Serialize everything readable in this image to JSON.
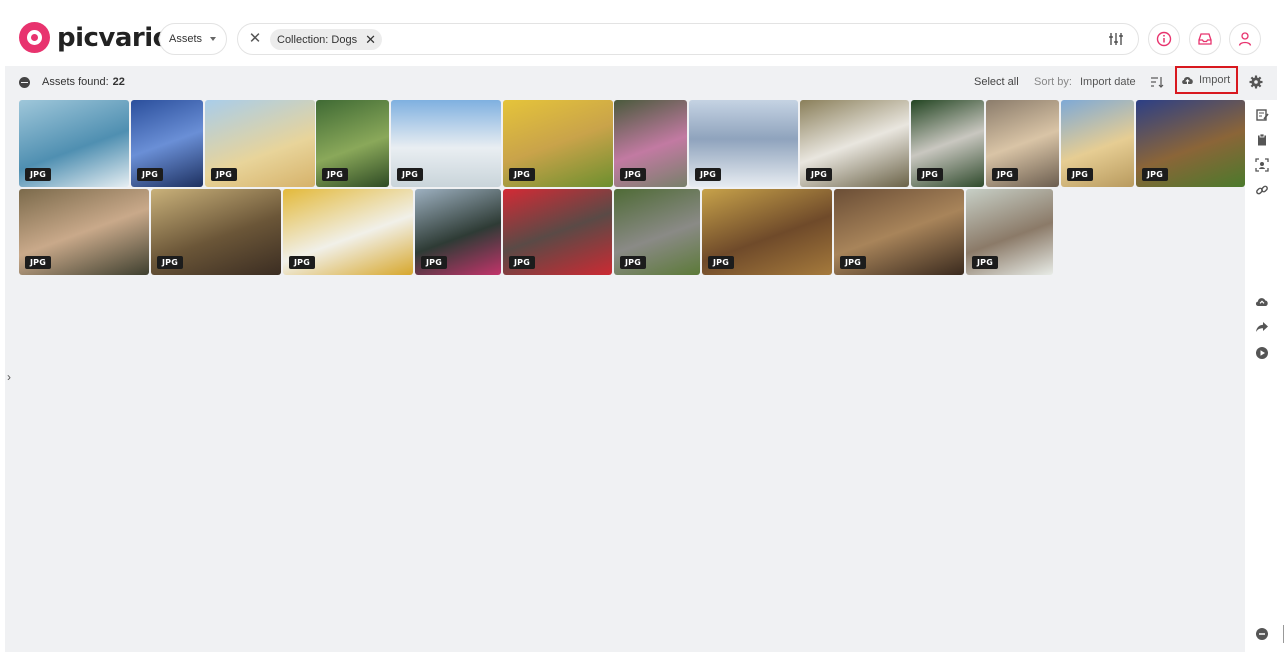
{
  "app": {
    "name": "picvario"
  },
  "header": {
    "scope_select": "Assets",
    "search_chip": "Collection: Dogs",
    "icons": [
      "filter-sliders-icon",
      "info-icon",
      "inbox-icon",
      "user-icon"
    ]
  },
  "toolbar": {
    "assets_found_label": "Assets found:",
    "assets_found_count": "22",
    "select_all": "Select all",
    "sort_label": "Sort by:",
    "sort_value": "Import date",
    "import_label": "Import"
  },
  "assets": [
    {
      "type": "JPG"
    },
    {
      "type": "JPG"
    },
    {
      "type": "JPG"
    },
    {
      "type": "JPG"
    },
    {
      "type": "JPG"
    },
    {
      "type": "JPG"
    },
    {
      "type": "JPG"
    },
    {
      "type": "JPG"
    },
    {
      "type": "JPG"
    },
    {
      "type": "JPG"
    },
    {
      "type": "JPG"
    },
    {
      "type": "JPG"
    },
    {
      "type": "JPG"
    },
    {
      "type": "JPG"
    },
    {
      "type": "JPG"
    },
    {
      "type": "JPG"
    },
    {
      "type": "JPG"
    },
    {
      "type": "JPG"
    },
    {
      "type": "JPG"
    },
    {
      "type": "JPG"
    },
    {
      "type": "JPG"
    },
    {
      "type": "JPG"
    }
  ],
  "colors": {
    "brand": "#e8336e",
    "highlight": "#d8181f",
    "panel_bg": "#f0f1f3"
  }
}
